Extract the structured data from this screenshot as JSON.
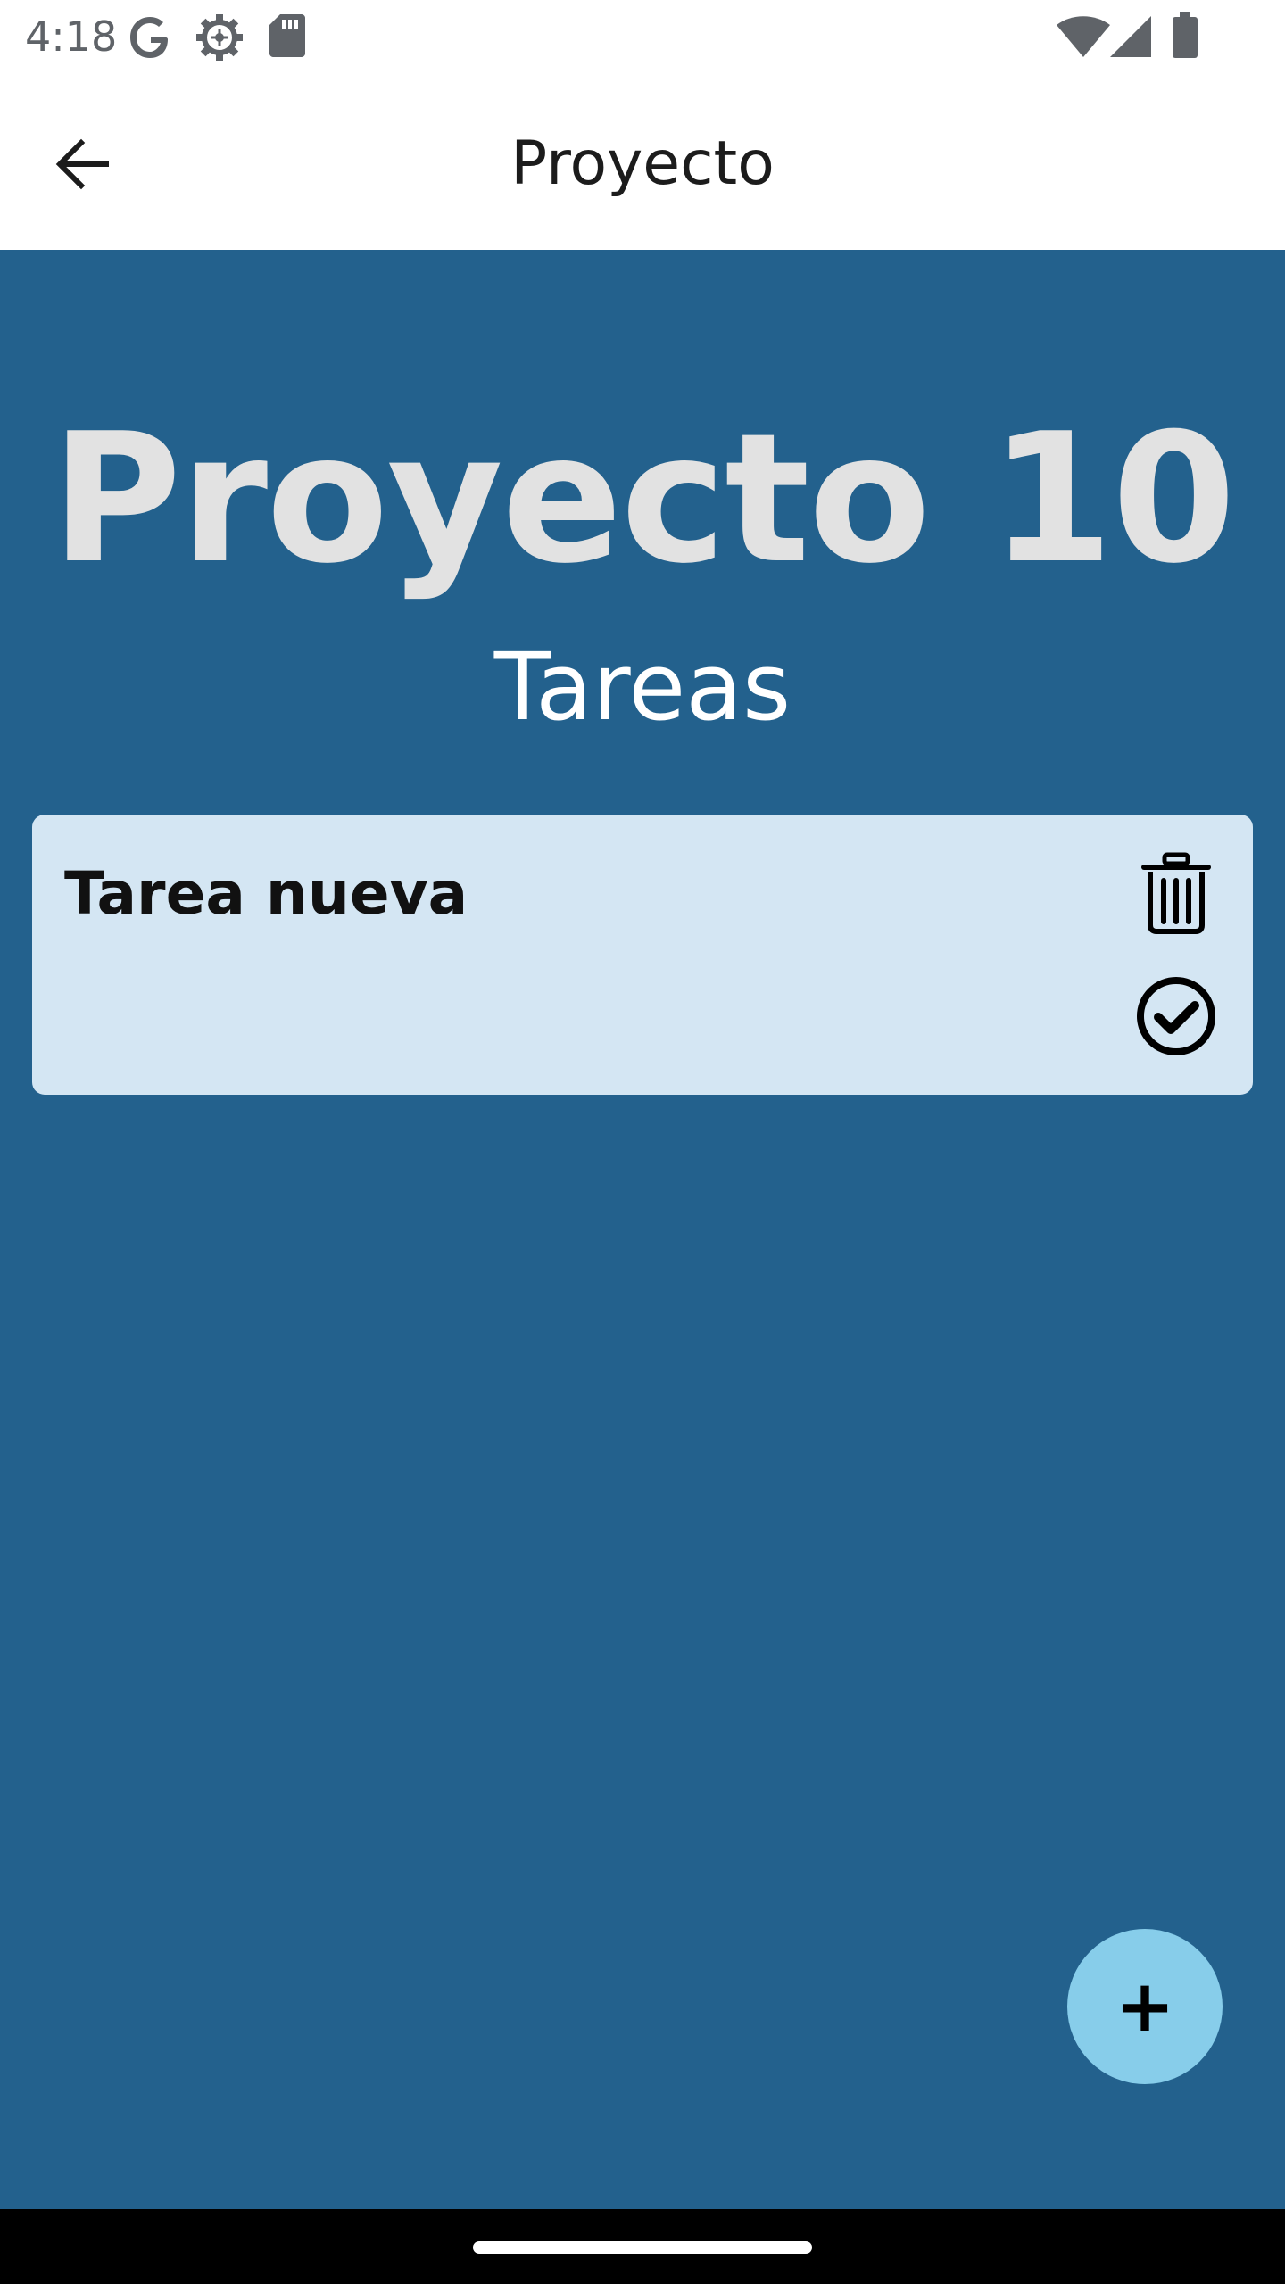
{
  "status_bar": {
    "time": "4:18",
    "icons": [
      "google-icon",
      "settings-gear-icon",
      "sd-card-icon",
      "wifi-icon",
      "cellular-signal-icon",
      "battery-icon"
    ]
  },
  "app_bar": {
    "title": "Proyecto",
    "back_icon": "arrow-back-icon"
  },
  "main": {
    "project_title": "Proyecto 10",
    "section_subtitle": "Tareas",
    "tasks": [
      {
        "name": "Tarea nueva",
        "delete_icon": "trash-icon",
        "complete_icon": "check-circle-icon"
      }
    ]
  },
  "fab": {
    "label": "+"
  },
  "colors": {
    "background": "#23618d",
    "card": "#d4e6f3",
    "fab": "#87cdea",
    "title_text": "#e2e2e2"
  }
}
